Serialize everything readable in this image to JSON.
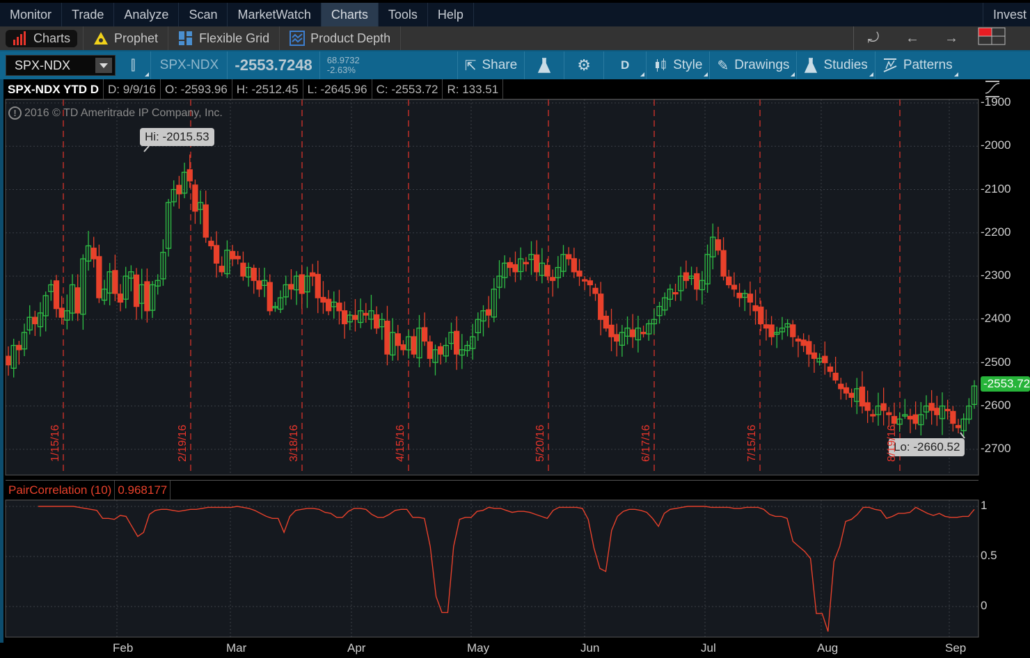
{
  "menubar": {
    "items": [
      {
        "label": "Monitor",
        "active": false
      },
      {
        "label": "Trade",
        "active": false
      },
      {
        "label": "Analyze",
        "active": false
      },
      {
        "label": "Scan",
        "active": false
      },
      {
        "label": "MarketWatch",
        "active": false
      },
      {
        "label": "Charts",
        "active": true
      },
      {
        "label": "Tools",
        "active": false
      },
      {
        "label": "Help",
        "active": false
      }
    ],
    "right_label": "Invest"
  },
  "subbar": {
    "items": [
      {
        "label": "Charts",
        "icon": "bar-chart-icon",
        "active": true
      },
      {
        "label": "Prophet",
        "icon": "prophet-eye-icon",
        "active": false
      },
      {
        "label": "Flexible Grid",
        "icon": "grid-icon",
        "active": false
      },
      {
        "label": "Product Depth",
        "icon": "product-depth-icon",
        "active": false
      }
    ],
    "right_icons": [
      "undo-icon",
      "back-arrow-icon",
      "forward-arrow-icon",
      "layout-grid-icon"
    ]
  },
  "toolbar": {
    "symbol": "SPX-NDX",
    "symbol_label": "SPX-NDX",
    "last_price": "-2553.7248",
    "net_change": "68.9732",
    "pct_change": "-2.63%",
    "share_label": "Share",
    "period_label": "D",
    "style_label": "Style",
    "drawings_label": "Drawings",
    "studies_label": "Studies",
    "patterns_label": "Patterns"
  },
  "infobar": {
    "title": "SPX-NDX YTD D",
    "date": "D: 9/9/16",
    "open": "O: -2593.96",
    "high": "H: -2512.45",
    "low": "L: -2645.96",
    "close": "C: -2553.72",
    "range": "R: 133.51"
  },
  "watermark": "2016 © TD Ameritrade IP Company, Inc.",
  "hi_bubble": "Hi: -2015.53",
  "lo_bubble": "Lo: -2660.52",
  "last_price_tag": "-2553.72",
  "colors": {
    "up": "#2fbf45",
    "down": "#e8412b",
    "marker": "#e8352b",
    "correlation": "#e8412b",
    "last_tag": "#27b43a",
    "toolbar": "#10658e"
  },
  "study": {
    "name": "PairCorrelation (10)",
    "value": "0.968177"
  },
  "chart_data": [
    {
      "type": "candlestick",
      "title": "SPX-NDX YTD D",
      "ylim": [
        -2740,
        -1880
      ],
      "y_ticks": [
        "-1900",
        "-2000",
        "-2100",
        "-2200",
        "-2300",
        "-2400",
        "-2500",
        "-2600",
        "-2700"
      ],
      "y_tick_values": [
        -1900,
        -2000,
        -2100,
        -2200,
        -2300,
        -2400,
        -2500,
        -2600,
        -2700
      ],
      "x_ticks": [
        "Feb",
        "Mar",
        "Apr",
        "May",
        "Jun",
        "Jul",
        "Aug",
        "Sep"
      ],
      "vertical_markers": [
        "1/15/16",
        "2/19/16",
        "3/18/16",
        "4/15/16",
        "5/20/16",
        "6/17/16",
        "7/15/16",
        "8/19/16"
      ],
      "annotations": {
        "high": -2015.53,
        "low": -2660.52,
        "last": -2553.72
      },
      "closes": [
        -2505,
        -2460,
        -2470,
        -2430,
        -2395,
        -2410,
        -2385,
        -2345,
        -2320,
        -2375,
        -2395,
        -2380,
        -2320,
        -2385,
        -2260,
        -2230,
        -2260,
        -2350,
        -2330,
        -2290,
        -2340,
        -2360,
        -2300,
        -2290,
        -2370,
        -2320,
        -2380,
        -2320,
        -2310,
        -2245,
        -2130,
        -2100,
        -2110,
        -2060,
        -2080,
        -2150,
        -2130,
        -2210,
        -2230,
        -2270,
        -2290,
        -2240,
        -2260,
        -2260,
        -2300,
        -2280,
        -2310,
        -2330,
        -2310,
        -2380,
        -2370,
        -2350,
        -2320,
        -2330,
        -2300,
        -2340,
        -2300,
        -2300,
        -2350,
        -2360,
        -2380,
        -2360,
        -2380,
        -2410,
        -2390,
        -2400,
        -2380,
        -2390,
        -2380,
        -2420,
        -2400,
        -2480,
        -2430,
        -2460,
        -2470,
        -2440,
        -2480,
        -2420,
        -2450,
        -2490,
        -2470,
        -2480,
        -2460,
        -2430,
        -2480,
        -2470,
        -2460,
        -2440,
        -2400,
        -2380,
        -2390,
        -2330,
        -2300,
        -2270,
        -2280,
        -2290,
        -2260,
        -2270,
        -2250,
        -2290,
        -2270,
        -2300,
        -2310,
        -2280,
        -2250,
        -2260,
        -2290,
        -2300,
        -2310,
        -2320,
        -2340,
        -2400,
        -2420,
        -2440,
        -2450,
        -2430,
        -2420,
        -2440,
        -2420,
        -2430,
        -2410,
        -2400,
        -2370,
        -2350,
        -2330,
        -2340,
        -2300,
        -2310,
        -2300,
        -2330,
        -2310,
        -2250,
        -2210,
        -2240,
        -2300,
        -2320,
        -2330,
        -2350,
        -2340,
        -2360,
        -2380,
        -2410,
        -2420,
        -2440,
        -2430,
        -2420,
        -2410,
        -2440,
        -2450,
        -2460,
        -2480,
        -2490,
        -2490,
        -2500,
        -2520,
        -2540,
        -2560,
        -2570,
        -2580,
        -2560,
        -2600,
        -2610,
        -2620,
        -2600,
        -2610,
        -2620,
        -2640,
        -2630,
        -2620,
        -2630,
        -2640,
        -2620,
        -2600,
        -2610,
        -2620,
        -2600,
        -2610,
        -2640,
        -2650,
        -2630,
        -2600,
        -2553.72
      ]
    },
    {
      "type": "line",
      "title": "PairCorrelation (10)",
      "ylim": [
        -0.3,
        1.1
      ],
      "y_ticks": [
        "1",
        "0.5",
        "0"
      ],
      "y_tick_values": [
        1,
        0.5,
        0
      ],
      "series": [
        {
          "name": "PairCorrelation (10)",
          "values": [
            1,
            1,
            1,
            1,
            1,
            1,
            1,
            0.99,
            0.98,
            0.97,
            0.96,
            0.88,
            0.88,
            0.87,
            0.91,
            0.9,
            0.8,
            0.7,
            0.74,
            0.92,
            0.96,
            0.97,
            0.97,
            0.96,
            0.95,
            0.96,
            0.97,
            0.97,
            0.98,
            0.99,
            0.99,
            0.99,
            0.99,
            0.99,
            1,
            0.99,
            0.98,
            0.96,
            0.93,
            0.9,
            0.88,
            0.88,
            0.74,
            0.9,
            0.96,
            0.97,
            0.98,
            0.98,
            0.97,
            0.94,
            0.93,
            0.89,
            0.89,
            0.95,
            0.98,
            0.98,
            0.97,
            0.92,
            0.89,
            0.89,
            0.92,
            0.96,
            0.97,
            0.97,
            0.89,
            0.89,
            0.88,
            0.6,
            0.1,
            -0.06,
            -0.06,
            0.6,
            0.87,
            0.89,
            0.89,
            0.95,
            0.96,
            0.99,
            0.98,
            0.98,
            0.96,
            0.94,
            0.95,
            0.95,
            0.94,
            0.92,
            0.9,
            0.88,
            0.96,
            0.99,
            0.99,
            0.99,
            0.99,
            0.98,
            0.87,
            0.58,
            0.38,
            0.35,
            0.76,
            0.9,
            0.95,
            0.97,
            0.97,
            0.96,
            0.94,
            0.88,
            0.8,
            0.93,
            0.97,
            0.98,
            0.99,
            1,
            1,
            1,
            1,
            0.99,
            0.99,
            0.99,
            0.99,
            0.98,
            0.98,
            0.99,
            0.99,
            0.99,
            0.97,
            0.92,
            0.9,
            0.9,
            0.88,
            0.65,
            0.6,
            0.55,
            0.48,
            -0.07,
            -0.07,
            -0.25,
            0.45,
            0.6,
            0.85,
            0.87,
            0.92,
            0.99,
            0.99,
            0.97,
            0.96,
            0.88,
            0.9,
            0.93,
            0.93,
            0.94,
            0.99,
            0.96,
            0.93,
            0.91,
            0.93,
            0.9,
            0.89,
            0.89,
            0.9,
            0.9,
            0.97
          ]
        }
      ]
    }
  ]
}
